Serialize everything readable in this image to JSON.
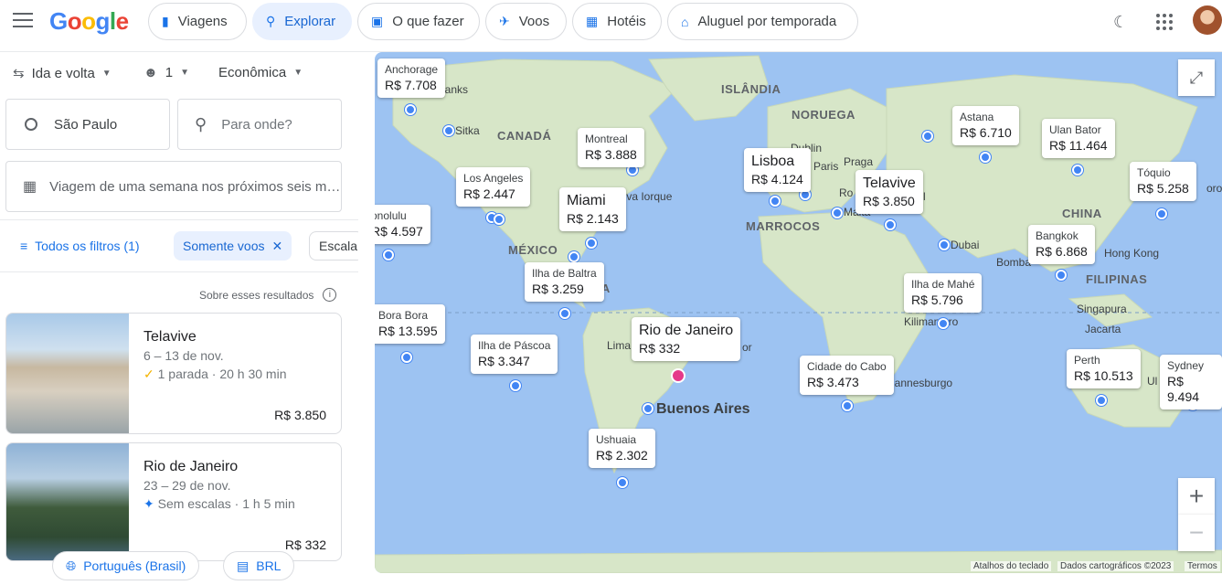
{
  "header": {
    "nav": [
      {
        "label": "Viagens",
        "icon": "luggage-icon"
      },
      {
        "label": "Explorar",
        "icon": "explore-icon"
      },
      {
        "label": "O que fazer",
        "icon": "camera-icon"
      },
      {
        "label": "Voos",
        "icon": "plane-icon"
      },
      {
        "label": "Hotéis",
        "icon": "bed-icon"
      },
      {
        "label": "Aluguel por temporada",
        "icon": "house-icon"
      }
    ]
  },
  "search": {
    "trip_type": "Ida e volta",
    "passengers": "1",
    "cabin": "Econômica",
    "origin": "São Paulo",
    "destination_placeholder": "Para onde?",
    "dates": "Viagem de uma semana nos próximos seis m…"
  },
  "filters": {
    "all": "Todos os filtros (1)",
    "nonstop": "Somente voos",
    "stops": "Escala"
  },
  "results_note": "Sobre esses resultados",
  "results": [
    {
      "city": "Telavive",
      "dates": "6 – 13 de nov.",
      "stops": "1 parada · 20 h 30 min",
      "price": "R$ 3.850"
    },
    {
      "city": "Rio de Janeiro",
      "dates": "23 – 29 de nov.",
      "stops": "Sem escalas · 1 h 5 min",
      "price": "R$ 332"
    }
  ],
  "footer": {
    "language": "Português (Brasil)",
    "currency": "BRL"
  },
  "map": {
    "tags": [
      {
        "name": "Anchorage",
        "price": "R$ 7.708"
      },
      {
        "name": "Montreal",
        "price": "R$ 3.888"
      },
      {
        "name": "Los Angeles",
        "price": "R$ 2.447"
      },
      {
        "name": "Miami",
        "price": "R$ 2.143"
      },
      {
        "name": "onolulu",
        "price": "R$ 4.597"
      },
      {
        "name": "Ilha de Baltra",
        "price": "R$ 3.259"
      },
      {
        "name": "Bora Bora",
        "price": "R$ 13.595"
      },
      {
        "name": "Ilha de Páscoa",
        "price": "R$ 3.347"
      },
      {
        "name": "Rio de Janeiro",
        "price": "R$ 332"
      },
      {
        "name": "Ushuaia",
        "price": "R$ 2.302"
      },
      {
        "name": "Lisboa",
        "price": "R$ 4.124"
      },
      {
        "name": "Telavive",
        "price": "R$ 3.850"
      },
      {
        "name": "Astana",
        "price": "R$ 6.710"
      },
      {
        "name": "Ulan Bator",
        "price": "R$ 11.464"
      },
      {
        "name": "Tóquio",
        "price": "R$ 5.258"
      },
      {
        "name": "Bangkok",
        "price": "R$ 6.868"
      },
      {
        "name": "Ilha de Mahé",
        "price": "R$ 5.796"
      },
      {
        "name": "Cidade do Cabo",
        "price": "R$ 3.473"
      },
      {
        "name": "Perth",
        "price": "R$ 10.513"
      },
      {
        "name": "Sydney",
        "price": "R$ 9.494"
      }
    ],
    "regions": [
      "CANADÁ",
      "ISLÂNDIA",
      "NORUEGA",
      "MÉXICO",
      "MARROCOS",
      "CHINA",
      "FILIPINAS",
      "CA"
    ],
    "cities": [
      "banks",
      "Sitka",
      "Nova Iorque",
      "Lima",
      "or",
      "Buenos Aires",
      "Dublin",
      "Paris",
      "Praga",
      "Ro",
      "Malta",
      "l",
      "Dubai",
      "Bomba",
      "Hong Kong",
      "Singapura",
      "Jacarta",
      "Kilimanjaro",
      "hannesburgo",
      "oro",
      "Ul"
    ],
    "attribution": [
      "Atalhos do teclado",
      "Dados cartográficos ©2023",
      "Termos"
    ]
  }
}
